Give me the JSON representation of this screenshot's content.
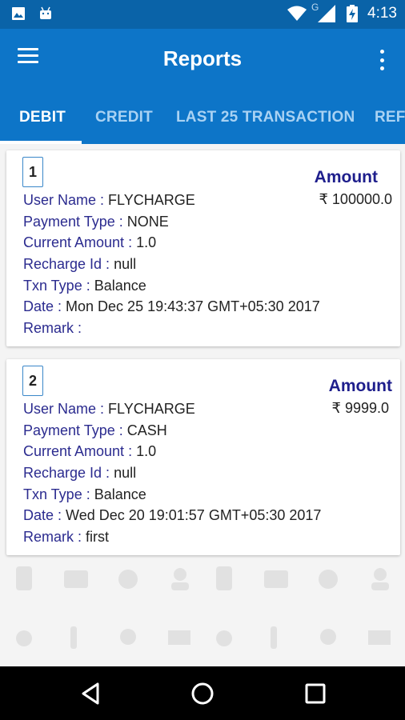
{
  "status_bar": {
    "time": "4:13",
    "network_label": "G",
    "icons": [
      "image-icon",
      "android-icon",
      "wifi-icon",
      "signal-icon",
      "battery-charging-icon"
    ]
  },
  "app_bar": {
    "title": "Reports",
    "menu_icon": "hamburger-menu-icon",
    "overflow_icon": "more-vert-icon"
  },
  "tabs": [
    {
      "label": "DEBIT",
      "active": true
    },
    {
      "label": "CREDIT",
      "active": false
    },
    {
      "label": "LAST 25 TRANSACTION",
      "active": false
    },
    {
      "label": "REFU",
      "active": false
    }
  ],
  "labels": {
    "amount": "Amount",
    "user_name": "User Name : ",
    "payment_type": "Payment Type : ",
    "current_amount": "Current Amount : ",
    "recharge_id": "Recharge Id : ",
    "txn_type": "Txn Type : ",
    "date": "Date : ",
    "remark": "Remark : "
  },
  "transactions": [
    {
      "index": "1",
      "amount": "₹ 100000.0",
      "user_name": "FLYCHARGE",
      "payment_type": "NONE",
      "current_amount": "1.0",
      "recharge_id": "null",
      "txn_type": "Balance",
      "date": "Mon Dec 25 19:43:37 GMT+05:30 2017",
      "remark": ""
    },
    {
      "index": "2",
      "amount": "₹ 9999.0",
      "user_name": "FLYCHARGE",
      "payment_type": "CASH",
      "current_amount": "1.0",
      "recharge_id": "null",
      "txn_type": "Balance",
      "date": "Wed Dec 20 19:01:57 GMT+05:30 2017",
      "remark": "first"
    }
  ],
  "nav_bar": {
    "icons": [
      "back-icon",
      "home-icon",
      "recents-icon"
    ]
  },
  "colors": {
    "status_bar": "#0a63a8",
    "app_bar": "#0d75c8",
    "label_text": "#2b2b8f",
    "amount_label": "#1e1e8c",
    "index_border": "#3a87c9"
  }
}
